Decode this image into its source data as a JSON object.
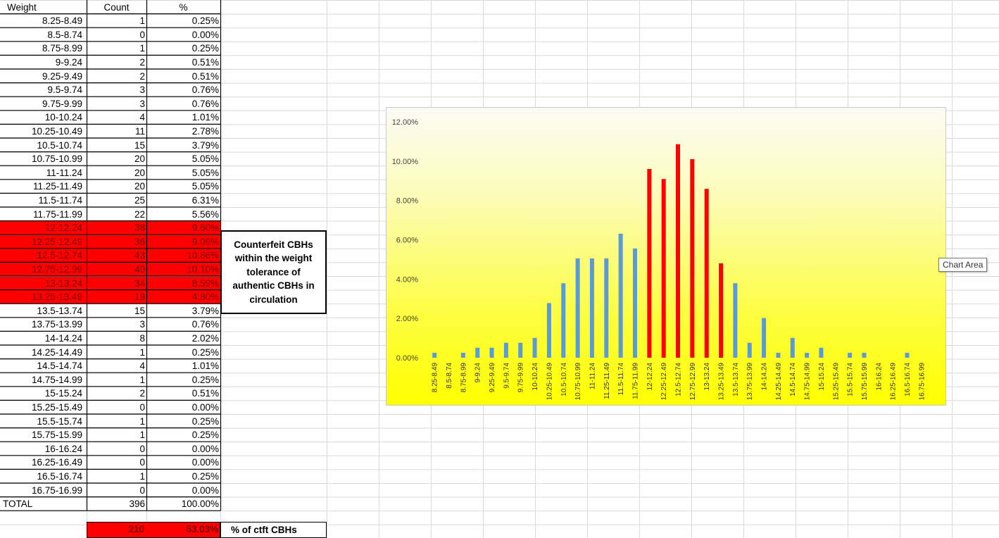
{
  "table": {
    "headers": {
      "weight": "Weight",
      "count": "Count",
      "pct": "%"
    },
    "rows": [
      {
        "weight": "8.25-8.49",
        "count": "1",
        "pct": "0.25%"
      },
      {
        "weight": "8.5-8.74",
        "count": "0",
        "pct": "0.00%"
      },
      {
        "weight": "8.75-8.99",
        "count": "1",
        "pct": "0.25%"
      },
      {
        "weight": "9-9.24",
        "count": "2",
        "pct": "0.51%"
      },
      {
        "weight": "9.25-9.49",
        "count": "2",
        "pct": "0.51%"
      },
      {
        "weight": "9.5-9.74",
        "count": "3",
        "pct": "0.76%"
      },
      {
        "weight": "9.75-9.99",
        "count": "3",
        "pct": "0.76%"
      },
      {
        "weight": "10-10.24",
        "count": "4",
        "pct": "1.01%"
      },
      {
        "weight": "10.25-10.49",
        "count": "11",
        "pct": "2.78%"
      },
      {
        "weight": "10.5-10.74",
        "count": "15",
        "pct": "3.79%"
      },
      {
        "weight": "10.75-10.99",
        "count": "20",
        "pct": "5.05%"
      },
      {
        "weight": "11-11.24",
        "count": "20",
        "pct": "5.05%"
      },
      {
        "weight": "11.25-11.49",
        "count": "20",
        "pct": "5.05%"
      },
      {
        "weight": "11.5-11.74",
        "count": "25",
        "pct": "6.31%"
      },
      {
        "weight": "11.75-11.99",
        "count": "22",
        "pct": "5.56%"
      },
      {
        "weight": "12-12.24",
        "count": "38",
        "pct": "9.60%",
        "highlight": true
      },
      {
        "weight": "12.25-12.49",
        "count": "36",
        "pct": "9.09%",
        "highlight": true
      },
      {
        "weight": "12.5-12.74",
        "count": "43",
        "pct": "10.86%",
        "highlight": true
      },
      {
        "weight": "12.75-12.99",
        "count": "40",
        "pct": "10.10%",
        "highlight": true
      },
      {
        "weight": "13-13.24",
        "count": "34",
        "pct": "8.59%",
        "highlight": true
      },
      {
        "weight": "13.25-13.49",
        "count": "19",
        "pct": "4.80%",
        "highlight": true
      },
      {
        "weight": "13.5-13.74",
        "count": "15",
        "pct": "3.79%"
      },
      {
        "weight": "13.75-13.99",
        "count": "3",
        "pct": "0.76%"
      },
      {
        "weight": "14-14.24",
        "count": "8",
        "pct": "2.02%"
      },
      {
        "weight": "14.25-14.49",
        "count": "1",
        "pct": "0.25%"
      },
      {
        "weight": "14.5-14.74",
        "count": "4",
        "pct": "1.01%"
      },
      {
        "weight": "14.75-14.99",
        "count": "1",
        "pct": "0.25%"
      },
      {
        "weight": "15-15.24",
        "count": "2",
        "pct": "0.51%"
      },
      {
        "weight": "15.25-15.49",
        "count": "0",
        "pct": "0.00%"
      },
      {
        "weight": "15.5-15.74",
        "count": "1",
        "pct": "0.25%"
      },
      {
        "weight": "15.75-15.99",
        "count": "1",
        "pct": "0.25%"
      },
      {
        "weight": "16-16.24",
        "count": "0",
        "pct": "0.00%"
      },
      {
        "weight": "16.25-16.49",
        "count": "0",
        "pct": "0.00%"
      },
      {
        "weight": "16.5-16.74",
        "count": "1",
        "pct": "0.25%"
      },
      {
        "weight": "16.75-16.99",
        "count": "0",
        "pct": "0.00%"
      }
    ],
    "total": {
      "label": "TOTAL",
      "count": "396",
      "pct": "100.00%"
    },
    "counterfeit_summary": {
      "count": "210",
      "pct": "53.03%",
      "label": "% of ctft CBHs"
    }
  },
  "annotation": {
    "text": "Counterfeit CBHs within the weight tolerance of authentic CBHs in circulation"
  },
  "tooltip": {
    "text": "Chart Area"
  },
  "colors": {
    "highlight_red": "#ff0000",
    "bar_blue": "#5b9bd5",
    "bar_red": "#ff0000",
    "chart_bg_top": "#fbfbf6",
    "chart_bg_bottom": "#ffff00"
  },
  "chart_data": {
    "type": "bar",
    "title": "",
    "xlabel": "",
    "ylabel": "",
    "ylim": [
      0,
      0.12
    ],
    "yticks": [
      "0.00%",
      "2.00%",
      "4.00%",
      "6.00%",
      "8.00%",
      "10.00%",
      "12.00%"
    ],
    "grid": false,
    "categories": [
      "8.25-8.49",
      "8.5-8.74",
      "8.75-8.99",
      "9-9.24",
      "9.25-9.49",
      "9.5-9.74",
      "9.75-9.99",
      "10-10.24",
      "10.25-10.49",
      "10.5-10.74",
      "10.75-10.99",
      "11-11.24",
      "11.25-11.49",
      "11.5-11.74",
      "11.75-11.99",
      "12-12.24",
      "12.25-12.49",
      "12.5-12.74",
      "12.75-12.99",
      "13-13.24",
      "13.25-13.49",
      "13.5-13.74",
      "13.75-13.99",
      "14-14.24",
      "14.25-14.49",
      "14.5-14.74",
      "14.75-14.99",
      "15-15.24",
      "15.25-15.49",
      "15.5-15.74",
      "15.75-15.99",
      "16-16.24",
      "16.25-16.49",
      "16.5-16.74",
      "16.75-16.99"
    ],
    "values": [
      0.0025,
      0,
      0.0025,
      0.0051,
      0.0051,
      0.0076,
      0.0076,
      0.0101,
      0.0278,
      0.0379,
      0.0505,
      0.0505,
      0.0505,
      0.0631,
      0.0556,
      0.096,
      0.0909,
      0.1086,
      0.101,
      0.0859,
      0.048,
      0.0379,
      0.0076,
      0.0202,
      0.0025,
      0.0101,
      0.0025,
      0.0051,
      0,
      0.0025,
      0.0025,
      0,
      0,
      0.0025,
      0
    ],
    "highlighted": [
      false,
      false,
      false,
      false,
      false,
      false,
      false,
      false,
      false,
      false,
      false,
      false,
      false,
      false,
      false,
      true,
      true,
      true,
      true,
      true,
      true,
      false,
      false,
      false,
      false,
      false,
      false,
      false,
      false,
      false,
      false,
      false,
      false,
      false,
      false
    ]
  }
}
